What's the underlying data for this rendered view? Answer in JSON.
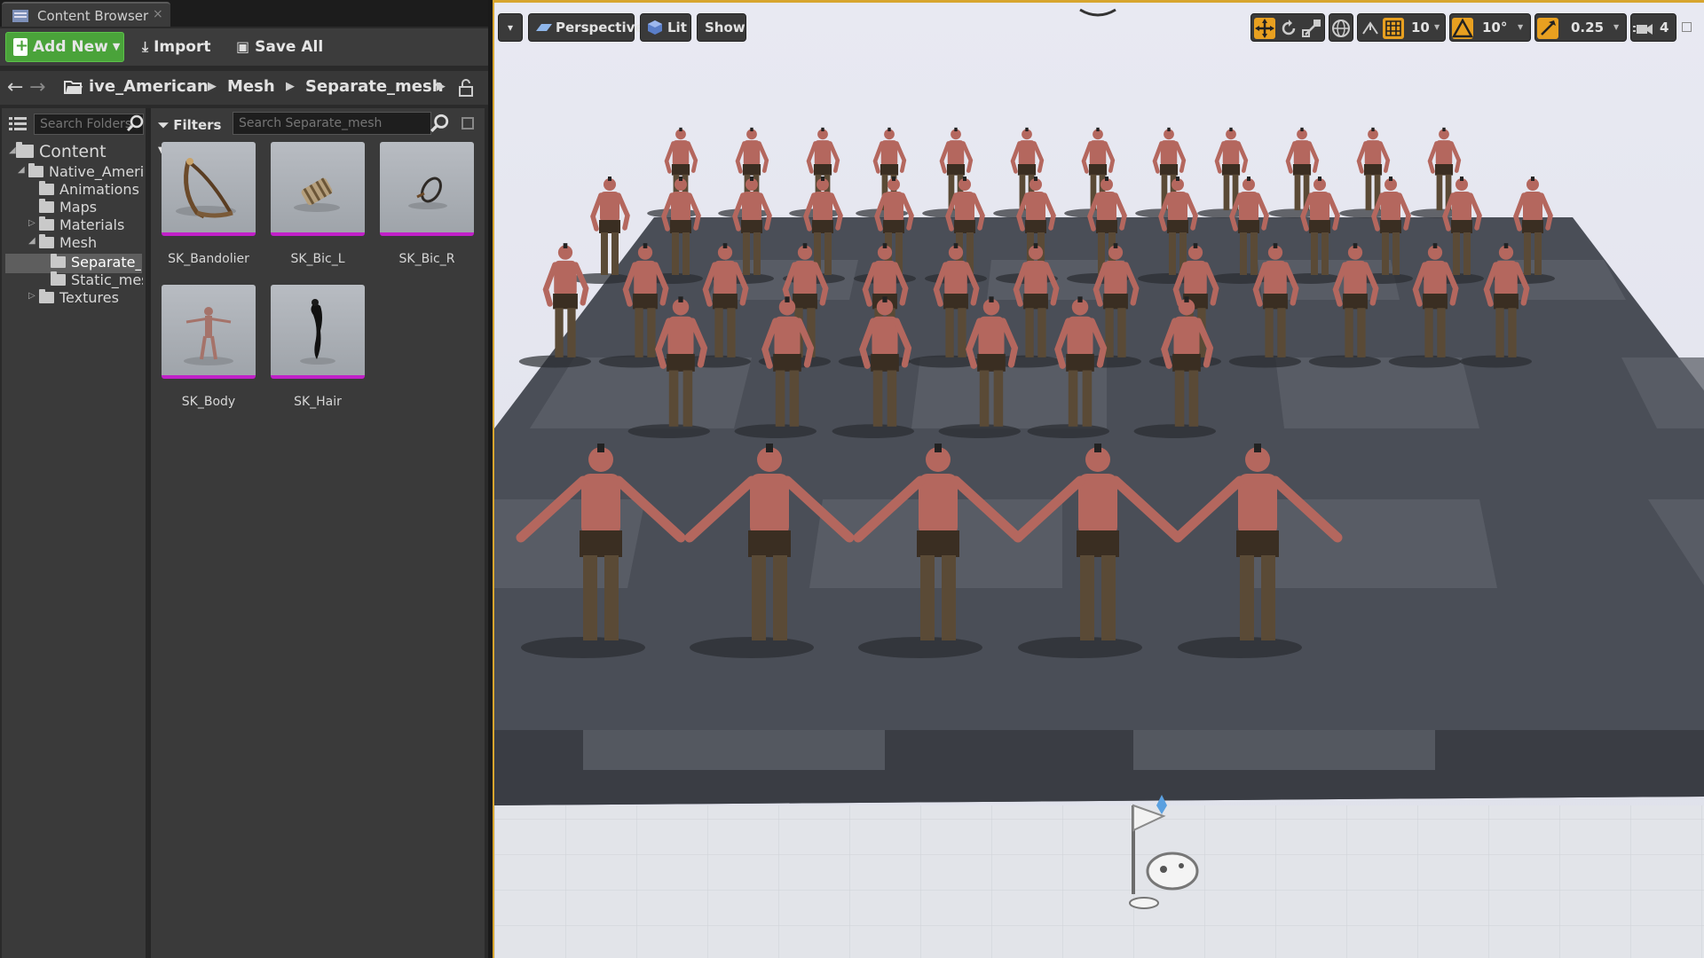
{
  "content_browser": {
    "tab_label": "Content Browser",
    "tab_close": "×",
    "toolbar": {
      "add_new_label": "Add New",
      "import_label": "Import",
      "save_all_label": "Save All"
    },
    "path": {
      "crumbs": [
        "ive_American",
        "Mesh",
        "Separate_mesh"
      ]
    },
    "tree": {
      "search_placeholder": "Search Folders",
      "items": [
        {
          "label": "Content"
        },
        {
          "label": "Native_American"
        },
        {
          "label": "Animations"
        },
        {
          "label": "Maps"
        },
        {
          "label": "Materials"
        },
        {
          "label": "Mesh"
        },
        {
          "label": "Separate_mesh"
        },
        {
          "label": "Static_mesh"
        },
        {
          "label": "Textures"
        }
      ]
    },
    "assets": {
      "filters_label": "Filters",
      "search_placeholder": "Search Separate_mesh",
      "items": [
        {
          "label": "SK_Bandolier"
        },
        {
          "label": "SK_Bic_L"
        },
        {
          "label": "SK_Bic_R"
        },
        {
          "label": "SK_Body"
        },
        {
          "label": "SK_Hair"
        }
      ]
    }
  },
  "viewport": {
    "menu_caret": "▾",
    "perspective_label": "Perspective",
    "lit_label": "Lit",
    "show_label": "Show",
    "grid_snap_value": "10",
    "rotation_snap_value": "10°",
    "scale_snap_value": "0.25",
    "camera_speed_value": "4"
  },
  "colors": {
    "add_new_green": "#4aa33a",
    "viewport_border": "#d7a52e",
    "asset_underline": "#c020c8",
    "snap_active_orange": "#e8a020"
  }
}
